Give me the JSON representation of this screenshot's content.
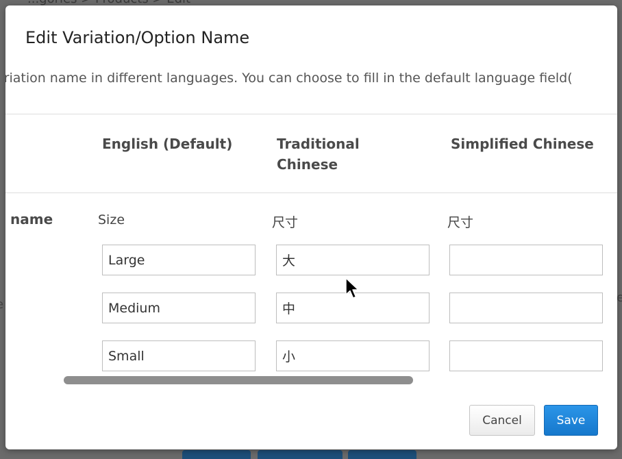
{
  "background": {
    "breadcrumb": "...gories > Products > Edit",
    "left_char": "e",
    "right_char": "e"
  },
  "dialog": {
    "title": "Edit Variation/Option Name",
    "instruction": "ariation name in different languages. You can choose to fill in the default language field("
  },
  "columns": {
    "english": "English (Default)",
    "traditional_chinese": "Traditional Chinese",
    "simplified_chinese": "Simplified Chinese"
  },
  "row": {
    "label": "name",
    "variation_name": {
      "english": "Size",
      "traditional_chinese": "尺寸",
      "simplified_chinese": "尺寸"
    },
    "options": [
      {
        "english": "Large",
        "traditional_chinese": "大",
        "simplified_chinese": ""
      },
      {
        "english": "Medium",
        "traditional_chinese": "中",
        "simplified_chinese": ""
      },
      {
        "english": "Small",
        "traditional_chinese": "小",
        "simplified_chinese": ""
      }
    ]
  },
  "buttons": {
    "cancel": "Cancel",
    "save": "Save"
  },
  "colors": {
    "primary": "#1a7fd6",
    "backdrop": "#6b6b6b"
  },
  "icons": {
    "cursor": "mouse-pointer-icon"
  }
}
